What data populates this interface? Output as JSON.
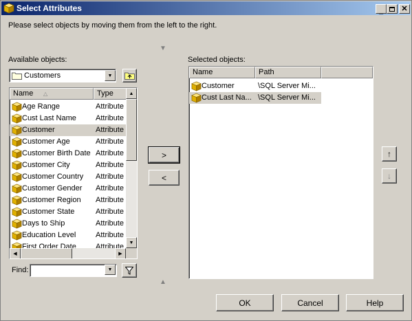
{
  "window": {
    "title": "Select Attributes"
  },
  "instruction": "Please select objects by moving them from the left to the right.",
  "available": {
    "label": "Available objects:",
    "folder": "Customers",
    "columns": [
      "Name",
      "Type"
    ],
    "items": [
      {
        "name": "Age Range",
        "type": "Attribute"
      },
      {
        "name": "Cust Last Name",
        "type": "Attribute"
      },
      {
        "name": "Customer",
        "type": "Attribute",
        "selected": true
      },
      {
        "name": "Customer Age",
        "type": "Attribute"
      },
      {
        "name": "Customer Birth Date",
        "type": "Attribute"
      },
      {
        "name": "Customer City",
        "type": "Attribute"
      },
      {
        "name": "Customer Country",
        "type": "Attribute"
      },
      {
        "name": "Customer Gender",
        "type": "Attribute"
      },
      {
        "name": "Customer Region",
        "type": "Attribute"
      },
      {
        "name": "Customer State",
        "type": "Attribute"
      },
      {
        "name": "Days to Ship",
        "type": "Attribute"
      },
      {
        "name": "Education Level",
        "type": "Attribute"
      },
      {
        "name": "First Order Date",
        "type": "Attribute"
      }
    ]
  },
  "selected": {
    "label": "Selected objects:",
    "columns": [
      "Name",
      "Path"
    ],
    "items": [
      {
        "name": "Customer",
        "path": "\\SQL Server Mi..."
      },
      {
        "name": "Cust Last Na...",
        "path": "\\SQL Server Mi...",
        "selected": true
      }
    ]
  },
  "buttons": {
    "add": ">",
    "remove": "<",
    "ok": "OK",
    "cancel": "Cancel",
    "help": "Help"
  },
  "find": {
    "label": "Find:",
    "value": ""
  }
}
